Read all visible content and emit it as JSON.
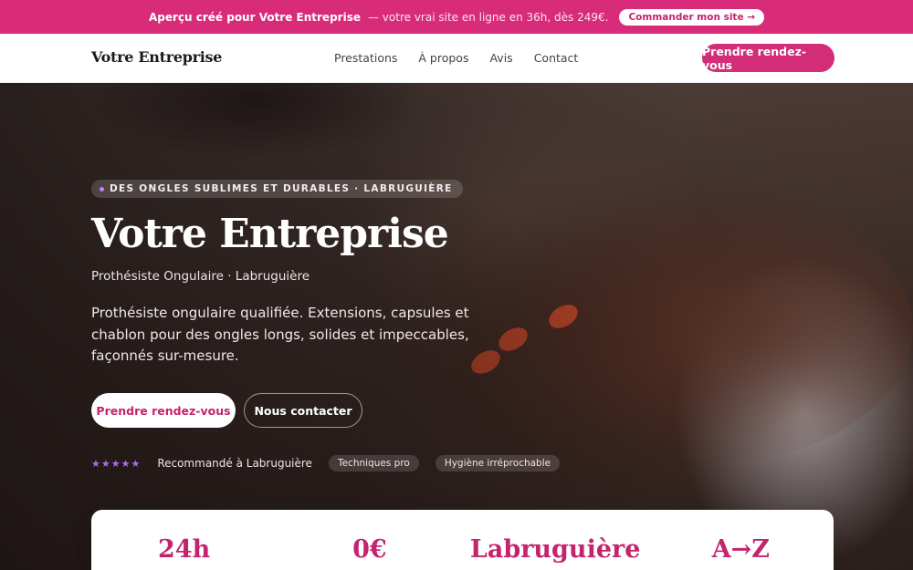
{
  "promo": {
    "highlight": "Aperçu créé pour Votre Entreprise",
    "rest": "— votre vrai site en ligne en 36h, dès 249€.",
    "button": "Commander mon site →",
    "accent": "#d82c7a"
  },
  "nav": {
    "brand": "Votre Entreprise",
    "links": [
      "Prestations",
      "À propos",
      "Avis",
      "Contact"
    ],
    "cta": "Prendre rendez-vous"
  },
  "hero": {
    "tagline": "DES ONGLES SUBLIMES ET DURABLES · LABRUGUIÈRE",
    "title": "Votre Entreprise",
    "subtitle": "Prothésiste Ongulaire · Labruguière",
    "description": "Prothésiste ongulaire qualifiée. Extensions, capsules et chablon pour des ongles longs, solides et impeccables, façonnés sur-mesure.",
    "primary_button": "Prendre rendez-vous",
    "secondary_button": "Nous contacter",
    "stars": "★★★★★",
    "recommendation": "Recommandé à Labruguière",
    "chips": [
      "Techniques pro",
      "Hygiène irréprochable"
    ]
  },
  "stats": [
    "24h",
    "0€",
    "Labruguière",
    "A→Z"
  ]
}
